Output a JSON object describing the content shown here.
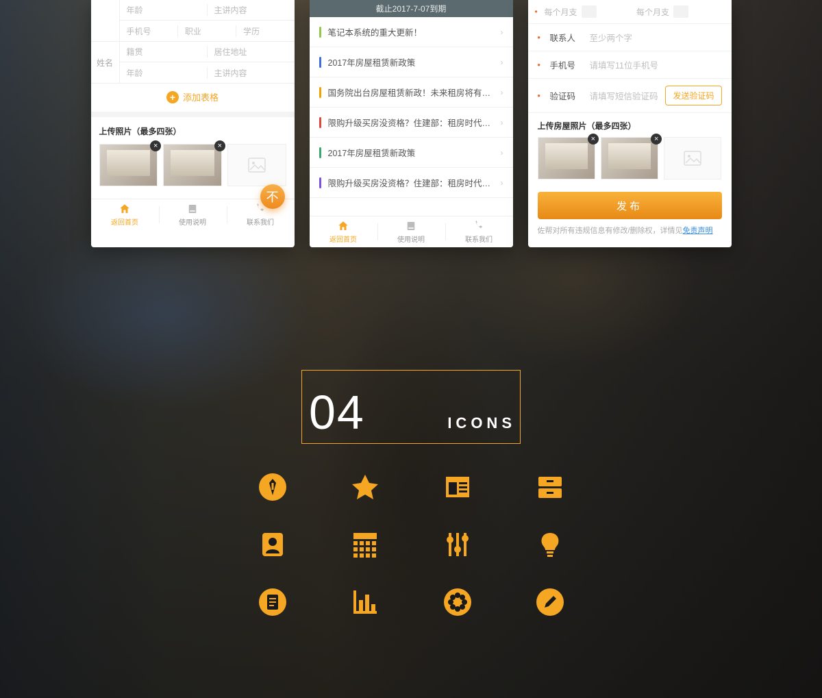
{
  "colors": {
    "accent": "#f5a623",
    "accent2": "#e78a17"
  },
  "phone1": {
    "name_label": "姓名",
    "cells": {
      "age": "年龄",
      "content": "主讲内容",
      "mobile": "手机号",
      "job": "职业",
      "edu": "学历",
      "hometown": "籍贯",
      "address": "居住地址"
    },
    "add": "添加表格",
    "upload_title": "上传照片（最多四张）",
    "fab_glyph": "不",
    "tabs": {
      "home": "返回首页",
      "guide": "使用说明",
      "contact": "联系我们"
    }
  },
  "phone2": {
    "deadline": "截止2017-7-07到期",
    "items": [
      {
        "color": "#8fc84a",
        "text": "笔记本系统的重大更新！"
      },
      {
        "color": "#3a6fe0",
        "text": "2017年房屋租赁新政策"
      },
      {
        "color": "#f2a100",
        "text": "国务院出台房屋租赁新政！未来租房将有什么..."
      },
      {
        "color": "#e0463a",
        "text": "限购升级买房没资格？住建部：租房时代要来了"
      },
      {
        "color": "#3aa86b",
        "text": "2017年房屋租赁新政策"
      },
      {
        "color": "#7c4fe0",
        "text": "限购升级买房没资格？住建部：租房时代要来了"
      }
    ],
    "tabs": {
      "home": "返回首页",
      "guide": "使用说明",
      "contact": "联系我们"
    }
  },
  "phone3": {
    "half_left": "每个月支",
    "half_right": "每个月支",
    "contact_label": "联系人",
    "contact_ph": "至少两个字",
    "mobile_label": "手机号",
    "mobile_ph": "请填写11位手机号",
    "code_label": "验证码",
    "code_ph": "请填写短信验证码",
    "send": "发送验证码",
    "upload_title": "上传房屋照片（最多四张）",
    "publish": "发布",
    "disclaimer_pre": "佐帮对所有违规信息有修改/删除权，详情见",
    "disclaimer_link": "免责声明"
  },
  "section": {
    "number": "04",
    "label": "ICONS"
  },
  "icons": [
    "suit-icon",
    "star-icon",
    "news-icon",
    "drawer-icon",
    "contact-card-icon",
    "calendar-grid-icon",
    "sliders-icon",
    "bulb-icon",
    "document-icon",
    "bar-chart-icon",
    "flower-icon",
    "edit-icon"
  ]
}
